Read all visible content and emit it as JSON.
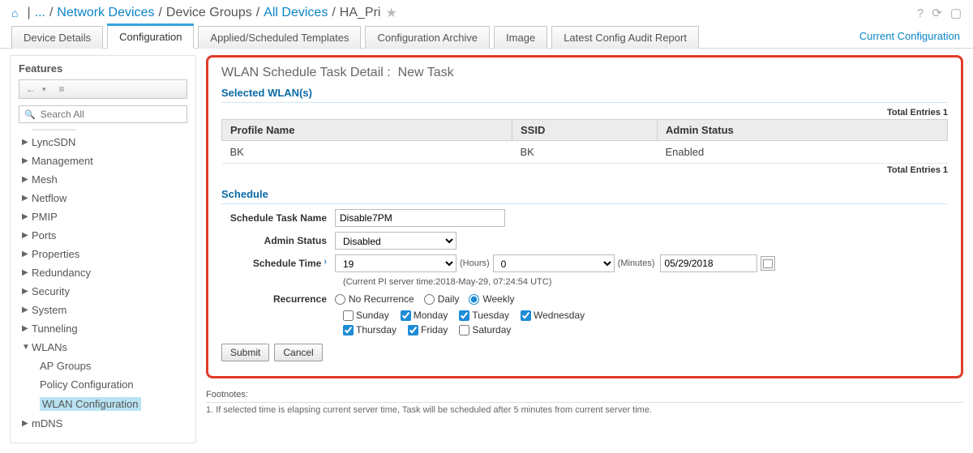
{
  "breadcrumb": {
    "root_ellipsis": "...",
    "link1": "Network Devices",
    "plain1": "Device Groups",
    "link2": "All Devices",
    "current": "HA_Pri"
  },
  "right_link": "Current Configuration",
  "tabs": {
    "t0": "Device Details",
    "t1": "Configuration",
    "t2": "Applied/Scheduled Templates",
    "t3": "Configuration Archive",
    "t4": "Image",
    "t5": "Latest Config Audit Report"
  },
  "sidebar": {
    "title": "Features",
    "search_placeholder": "Search All",
    "items": [
      "LyncSDN",
      "Management",
      "Mesh",
      "Netflow",
      "PMIP",
      "Ports",
      "Properties",
      "Redundancy",
      "Security",
      "System",
      "Tunneling",
      "WLANs"
    ],
    "wlan_children": [
      "AP Groups",
      "Policy Configuration",
      "WLAN Configuration"
    ],
    "last": "mDNS"
  },
  "page": {
    "title_prefix": "WLAN Schedule Task Detail :",
    "title_task": "New Task",
    "selected_header": "Selected WLAN(s)",
    "total_entries": "Total Entries 1",
    "cols": {
      "c0": "Profile Name",
      "c1": "SSID",
      "c2": "Admin Status"
    },
    "row": {
      "profile": "BK",
      "ssid": "BK",
      "admin": "Enabled"
    },
    "schedule_header": "Schedule",
    "labels": {
      "task_name": "Schedule Task Name",
      "admin_status": "Admin Status",
      "schedule_time": "Schedule Time",
      "recurrence": "Recurrence",
      "hours": "(Hours)",
      "minutes": "(Minutes)"
    },
    "values": {
      "task_name": "Disable7PM",
      "admin_status": "Disabled",
      "hour": "19",
      "minute": "0",
      "date": "05/29/2018",
      "server_time": "(Current PI server time:2018-May-29, 07:24:54 UTC)"
    },
    "recurrence_opts": {
      "none": "No Recurrence",
      "daily": "Daily",
      "weekly": "Weekly"
    },
    "days": {
      "sun": "Sunday",
      "mon": "Monday",
      "tue": "Tuesday",
      "wed": "Wednesday",
      "thu": "Thursday",
      "fri": "Friday",
      "sat": "Saturday"
    },
    "buttons": {
      "submit": "Submit",
      "cancel": "Cancel"
    },
    "footnotes_label": "Footnotes:",
    "footnote1": "1. If selected time is elapsing current server time, Task will be scheduled after 5 minutes from current server time."
  }
}
